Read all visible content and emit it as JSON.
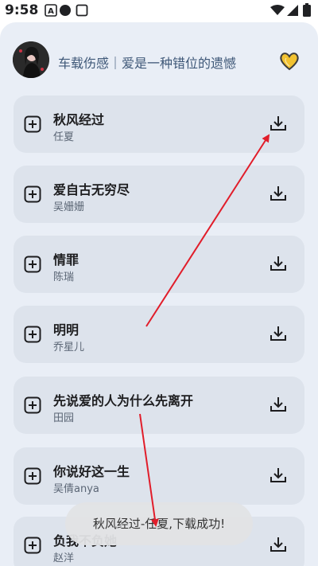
{
  "status_bar": {
    "time": "9:58",
    "notification_icons": [
      "a-box-icon",
      "circle-icon",
      "square-icon"
    ],
    "system_icons": [
      "wifi-icon",
      "signal-icon",
      "battery-icon"
    ]
  },
  "header": {
    "playlist_title": "车载伤感｜爱是一种错位的遗憾",
    "avatar": "avatar"
  },
  "songs": [
    {
      "title": "秋风经过",
      "artist": "任夏"
    },
    {
      "title": "爱自古无穷尽",
      "artist": "吴姗姗"
    },
    {
      "title": "情罪",
      "artist": "陈瑞"
    },
    {
      "title": "明明",
      "artist": "乔星儿"
    },
    {
      "title": "先说爱的人为什么先离开",
      "artist": "田园"
    },
    {
      "title": "你说好这一生",
      "artist": "吴倩anya"
    },
    {
      "title": "负我不负她",
      "artist": "赵洋"
    }
  ],
  "toast": {
    "message": "秋风经过-任夏,下载成功!"
  },
  "colors": {
    "sheet_bg": "#e9eef6",
    "card_bg": "#dde3ec",
    "title_text": "#3f5878",
    "annotation_arrow": "#e11d2a",
    "heart_fill": "#f2c230"
  }
}
